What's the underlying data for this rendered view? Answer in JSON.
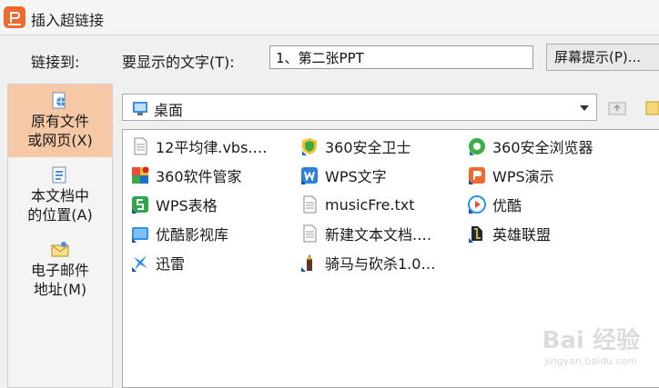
{
  "window": {
    "title": "插入超链接"
  },
  "form": {
    "link_to_label": "链接到:",
    "display_text_label": "要显示的文字(T):",
    "display_text_value": "1、第二张PPT",
    "screentip_button": "屏幕提示(P)..."
  },
  "sidebar": {
    "items": [
      {
        "label_line1": "原有文件",
        "label_line2": "或网页(X)",
        "icon": "file-globe-icon",
        "active": true
      },
      {
        "label_line1": "本文档中",
        "label_line2": "的位置(A)",
        "icon": "document-place-icon",
        "active": false
      },
      {
        "label_line1": "电子邮件",
        "label_line2": "地址(M)",
        "icon": "email-icon",
        "active": false
      }
    ]
  },
  "location": {
    "current": "桌面",
    "icon": "desktop-folder-icon"
  },
  "files": [
    {
      "name": "12平均律.vbs.…",
      "icon": "text-file-icon"
    },
    {
      "name": "360安全卫士",
      "icon": "360-safe-icon"
    },
    {
      "name": "360安全浏览器",
      "icon": "360-browser-icon"
    },
    {
      "name": "360软件管家",
      "icon": "360-software-icon"
    },
    {
      "name": "WPS文字",
      "icon": "wps-writer-icon"
    },
    {
      "name": "WPS演示",
      "icon": "wps-presentation-icon"
    },
    {
      "name": "WPS表格",
      "icon": "wps-spreadsheet-icon"
    },
    {
      "name": "musicFre.txt",
      "icon": "text-file-icon"
    },
    {
      "name": "优酷",
      "icon": "youku-icon"
    },
    {
      "name": "优酷影视库",
      "icon": "youku-library-icon"
    },
    {
      "name": "新建文本文档.…",
      "icon": "text-file-icon"
    },
    {
      "name": "英雄联盟",
      "icon": "lol-icon"
    },
    {
      "name": "迅雷",
      "icon": "thunder-icon"
    },
    {
      "name": "骑马与砍杀1.0…",
      "icon": "mount-blade-icon"
    }
  ],
  "watermark": {
    "main": "Bai 经验",
    "sub": "jingyan.baidu.com"
  }
}
